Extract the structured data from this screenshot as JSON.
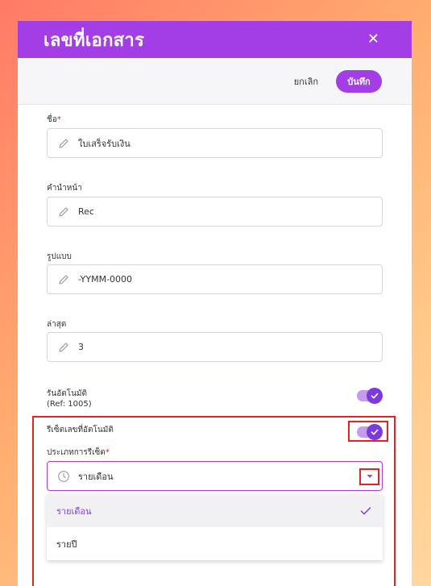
{
  "modal": {
    "title": "เลขที่เอกสาร",
    "close_icon": "close-icon"
  },
  "toolbar": {
    "cancel_label": "ยกเลิก",
    "save_label": "บันทึก"
  },
  "fields": {
    "name": {
      "label": "ชื่อ",
      "required_mark": "*",
      "value": "ใบเสร็จรับเงิน",
      "icon": "pencil-icon"
    },
    "prefix": {
      "label": "คำนำหน้า",
      "value": "Rec",
      "icon": "pencil-icon"
    },
    "format": {
      "label": "รูปแบบ",
      "value": "-YYMM-0000",
      "icon": "pencil-icon"
    },
    "latest": {
      "label": "ล่าสุด",
      "value": "3",
      "icon": "pencil-icon"
    }
  },
  "auto_run": {
    "label": "รันอัตโนมัติ",
    "ref": "(Ref: 1005)",
    "enabled": true
  },
  "auto_reset": {
    "label": "รีเซ็ตเลขที่อัตโนมัติ",
    "enabled": true
  },
  "reset_type": {
    "label": "ประเภทการรีเซ็ต",
    "required_mark": "*",
    "value": "รายเดือน",
    "icon": "clock-icon",
    "options": [
      {
        "label": "รายเดือน",
        "selected": true
      },
      {
        "label": "รายปี",
        "selected": false
      }
    ]
  },
  "colors": {
    "accent": "#a33ee6",
    "highlight": "#e02424"
  }
}
